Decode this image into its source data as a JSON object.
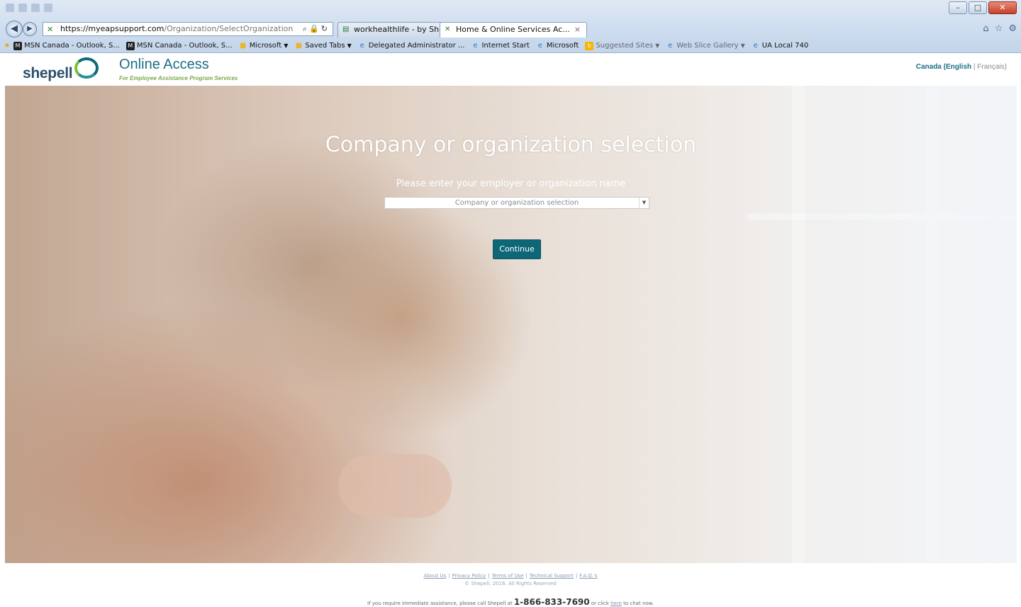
{
  "browser": {
    "address_host": "https://myeapsupport.com",
    "address_path": "/Organization/SelectOrganization",
    "tabs": [
      {
        "label": "workhealthlife - by Shepell"
      },
      {
        "label": "Home & Online Services Ac...",
        "close": "×"
      }
    ],
    "favorites": [
      {
        "label": "MSN Canada - Outlook, S..."
      },
      {
        "label": "MSN Canada - Outlook, S..."
      },
      {
        "label": "Microsoft"
      },
      {
        "label": "Saved Tabs"
      },
      {
        "label": "Delegated Administrator ..."
      },
      {
        "label": "Internet Start"
      },
      {
        "label": "Microsoft"
      },
      {
        "label": "Suggested Sites"
      },
      {
        "label": "Web Slice Gallery"
      },
      {
        "label": "UA Local 740"
      }
    ]
  },
  "header": {
    "logo_text": "shepell",
    "title": "Online Access",
    "subtitle": "For Employee Assistance Program Services",
    "language": {
      "country": "Canada",
      "open_paren": "(",
      "current": "English",
      "separator": "|",
      "other": "Français",
      "close_paren": ")"
    }
  },
  "form": {
    "title": "Company or organization selection",
    "prompt": "Please enter your employer or organization name",
    "select_placeholder": "Company or organization selection",
    "continue_label": "Continue"
  },
  "footer": {
    "links": [
      "About Us",
      "Privacy Policy",
      "Terms of Use",
      "Technical Support",
      "F.A.Q.'s"
    ],
    "link_separator": "|",
    "copyright": "© Shepell, 2016. All Rights Reserved",
    "assist_prefix": "If you require immediate assistance, please call Shepell at",
    "phone": "1-866-833-7690",
    "assist_middle": "or click",
    "here_link": "here",
    "assist_suffix": "to chat now."
  }
}
